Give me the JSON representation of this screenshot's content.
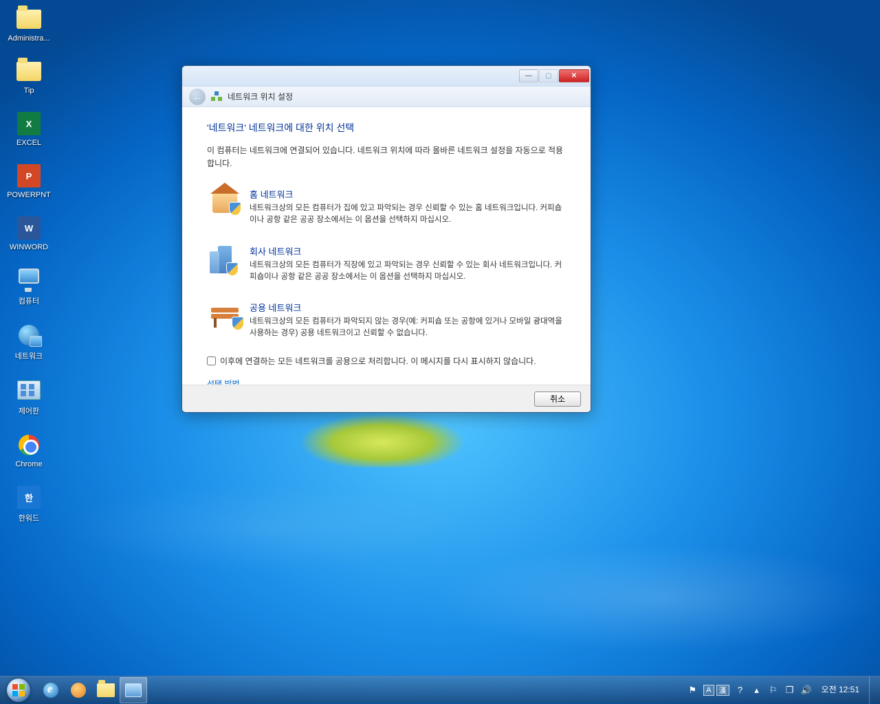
{
  "desktop": {
    "icons": [
      {
        "label": "Administra...",
        "kind": "folder"
      },
      {
        "label": "Tip",
        "kind": "folder"
      },
      {
        "label": "EXCEL",
        "kind": "tile-xl",
        "glyph": "X"
      },
      {
        "label": "POWERPNT",
        "kind": "tile-pp",
        "glyph": "P"
      },
      {
        "label": "WINWORD",
        "kind": "tile-wd",
        "glyph": "W"
      },
      {
        "label": "컴퓨터",
        "kind": "monitor"
      },
      {
        "label": "네트워크",
        "kind": "netglobe"
      },
      {
        "label": "제어판",
        "kind": "cpanel"
      },
      {
        "label": "Chrome",
        "kind": "chrome"
      },
      {
        "label": "한워드",
        "kind": "tile-hw",
        "glyph": "한"
      }
    ]
  },
  "dialog": {
    "nav_title": "네트워크 위치 설정",
    "heading": "'네트워크' 네트워크에 대한 위치 선택",
    "intro": "이 컴퓨터는 네트워크에 연결되어 있습니다. 네트워크 위치에 따라 올바른 네트워크 설정을 자동으로 적용합니다.",
    "options": [
      {
        "title": "홈 네트워크",
        "desc": "네트워크상의 모든 컴퓨터가 집에 있고 파악되는 경우 신뢰할 수 있는 홈 네트워크입니다. 커피숍이나 공항 같은 공공 장소에서는 이 옵션을 선택하지 마십시오."
      },
      {
        "title": "회사 네트워크",
        "desc": "네트워크상의 모든 컴퓨터가 직장에 있고 파악되는 경우 신뢰할 수 있는 회사 네트워크입니다. 커피숍이나 공항 같은 공공 장소에서는 이 옵션을 선택하지 마십시오."
      },
      {
        "title": "공용 네트워크",
        "desc": "네트워크상의 모든 컴퓨터가 파악되지 않는 경우(예: 커피숍 또는 공항에 있거나 모바일 광대역을 사용하는 경우) 공용 네트워크이고 신뢰할 수 없습니다."
      }
    ],
    "checkbox_label": "이후에 연결하는 모든 네트워크를 공용으로 처리합니다. 이 메시지를 다시 표시하지 않습니다.",
    "help_link": "선택 방법",
    "cancel": "취소"
  },
  "taskbar": {
    "lang_a": "A",
    "lang_han": "漢",
    "clock": "오전 12:51"
  }
}
